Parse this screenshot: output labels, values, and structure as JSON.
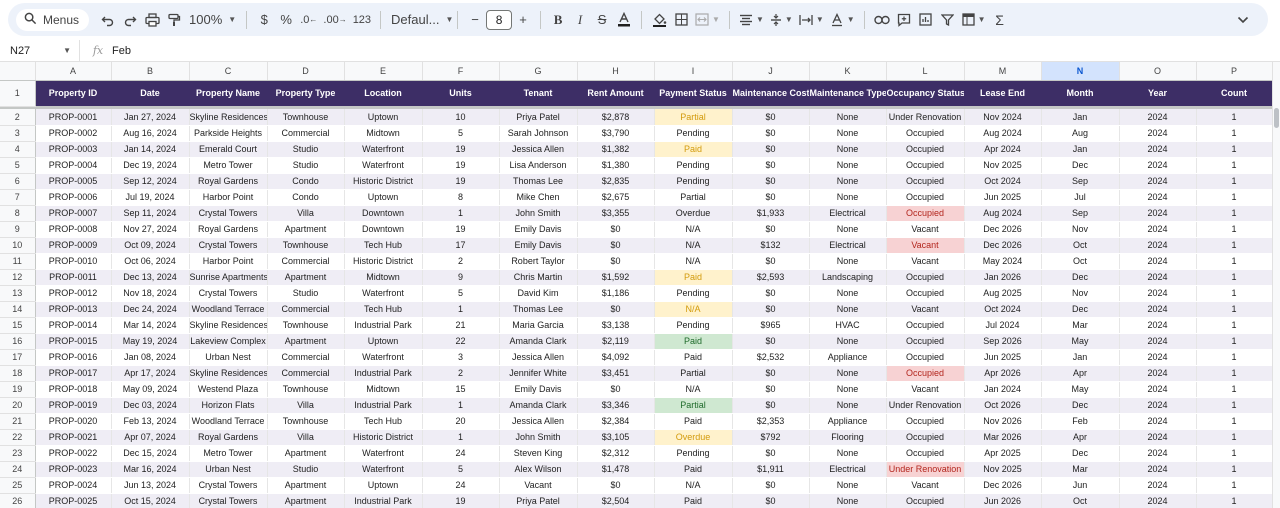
{
  "toolbar": {
    "menus_label": "Menus",
    "zoom": "100%",
    "currency_symbol": "$",
    "percent_symbol": "%",
    "decrease_decimal": ".0",
    "increase_decimal": ".00",
    "number_format": "123",
    "font_name": "Defaul...",
    "font_size": "8"
  },
  "formula_bar": {
    "cell_ref": "N27",
    "value": "Feb"
  },
  "columns": [
    "A",
    "B",
    "C",
    "D",
    "E",
    "F",
    "G",
    "H",
    "I",
    "J",
    "K",
    "L",
    "M",
    "N",
    "O",
    "P"
  ],
  "selected_column": "N",
  "headers": [
    "Property ID",
    "Date",
    "Property Name",
    "Property Type",
    "Location",
    "Units",
    "Tenant",
    "Rent Amount",
    "Payment Status",
    "Maintenance Cost",
    "Maintenance Type",
    "Occupancy Status",
    "Lease End",
    "Month",
    "Year",
    "Count"
  ],
  "rows": [
    [
      "PROP-0001",
      "Jan 27, 2024",
      "Skyline Residences",
      "Townhouse",
      "Uptown",
      "10",
      "Priya Patel",
      "$2,878",
      "Partial",
      "$0",
      "None",
      "Under Renovation",
      "Nov 2024",
      "Jan",
      "2024",
      "1"
    ],
    [
      "PROP-0002",
      "Aug 16, 2024",
      "Parkside Heights",
      "Commercial",
      "Midtown",
      "5",
      "Sarah Johnson",
      "$3,790",
      "Pending",
      "$0",
      "None",
      "Occupied",
      "Aug 2024",
      "Aug",
      "2024",
      "1"
    ],
    [
      "PROP-0003",
      "Jan 14, 2024",
      "Emerald Court",
      "Studio",
      "Waterfront",
      "19",
      "Jessica Allen",
      "$1,382",
      "Paid",
      "$0",
      "None",
      "Occupied",
      "Apr 2024",
      "Jan",
      "2024",
      "1"
    ],
    [
      "PROP-0004",
      "Dec 19, 2024",
      "Metro Tower",
      "Studio",
      "Waterfront",
      "19",
      "Lisa Anderson",
      "$1,380",
      "Pending",
      "$0",
      "None",
      "Occupied",
      "Nov 2025",
      "Dec",
      "2024",
      "1"
    ],
    [
      "PROP-0005",
      "Sep 12, 2024",
      "Royal Gardens",
      "Condo",
      "Historic District",
      "19",
      "Thomas Lee",
      "$2,835",
      "Pending",
      "$0",
      "None",
      "Occupied",
      "Oct 2024",
      "Sep",
      "2024",
      "1"
    ],
    [
      "PROP-0006",
      "Jul 19, 2024",
      "Harbor Point",
      "Condo",
      "Uptown",
      "8",
      "Mike Chen",
      "$2,675",
      "Partial",
      "$0",
      "None",
      "Occupied",
      "Jun 2025",
      "Jul",
      "2024",
      "1"
    ],
    [
      "PROP-0007",
      "Sep 11, 2024",
      "Crystal Towers",
      "Villa",
      "Downtown",
      "1",
      "John Smith",
      "$3,355",
      "Overdue",
      "$1,933",
      "Electrical",
      "Occupied",
      "Aug 2024",
      "Sep",
      "2024",
      "1"
    ],
    [
      "PROP-0008",
      "Nov 27, 2024",
      "Royal Gardens",
      "Apartment",
      "Downtown",
      "19",
      "Emily Davis",
      "$0",
      "N/A",
      "$0",
      "None",
      "Vacant",
      "Dec 2026",
      "Nov",
      "2024",
      "1"
    ],
    [
      "PROP-0009",
      "Oct 09, 2024",
      "Crystal Towers",
      "Townhouse",
      "Tech Hub",
      "17",
      "Emily Davis",
      "$0",
      "N/A",
      "$132",
      "Electrical",
      "Vacant",
      "Dec 2026",
      "Oct",
      "2024",
      "1"
    ],
    [
      "PROP-0010",
      "Oct 06, 2024",
      "Harbor Point",
      "Commercial",
      "Historic District",
      "2",
      "Robert Taylor",
      "$0",
      "N/A",
      "$0",
      "None",
      "Vacant",
      "May 2024",
      "Oct",
      "2024",
      "1"
    ],
    [
      "PROP-0011",
      "Dec 13, 2024",
      "Sunrise Apartments",
      "Apartment",
      "Midtown",
      "9",
      "Chris Martin",
      "$1,592",
      "Paid",
      "$2,593",
      "Landscaping",
      "Occupied",
      "Jan 2026",
      "Dec",
      "2024",
      "1"
    ],
    [
      "PROP-0012",
      "Nov 18, 2024",
      "Crystal Towers",
      "Studio",
      "Waterfront",
      "5",
      "David Kim",
      "$1,186",
      "Pending",
      "$0",
      "None",
      "Occupied",
      "Aug 2025",
      "Nov",
      "2024",
      "1"
    ],
    [
      "PROP-0013",
      "Dec 24, 2024",
      "Woodland Terrace",
      "Commercial",
      "Tech Hub",
      "1",
      "Thomas Lee",
      "$0",
      "N/A",
      "$0",
      "None",
      "Vacant",
      "Oct 2024",
      "Dec",
      "2024",
      "1"
    ],
    [
      "PROP-0014",
      "Mar 14, 2024",
      "Skyline Residences",
      "Townhouse",
      "Industrial Park",
      "21",
      "Maria Garcia",
      "$3,138",
      "Pending",
      "$965",
      "HVAC",
      "Occupied",
      "Jul 2024",
      "Mar",
      "2024",
      "1"
    ],
    [
      "PROP-0015",
      "May 19, 2024",
      "Lakeview Complex",
      "Apartment",
      "Uptown",
      "22",
      "Amanda Clark",
      "$2,119",
      "Paid",
      "$0",
      "None",
      "Occupied",
      "Sep 2026",
      "May",
      "2024",
      "1"
    ],
    [
      "PROP-0016",
      "Jan 08, 2024",
      "Urban Nest",
      "Commercial",
      "Waterfront",
      "3",
      "Jessica Allen",
      "$4,092",
      "Paid",
      "$2,532",
      "Appliance",
      "Occupied",
      "Jun 2025",
      "Jan",
      "2024",
      "1"
    ],
    [
      "PROP-0017",
      "Apr 17, 2024",
      "Skyline Residences",
      "Commercial",
      "Industrial Park",
      "2",
      "Jennifer White",
      "$3,451",
      "Partial",
      "$0",
      "None",
      "Occupied",
      "Apr 2026",
      "Apr",
      "2024",
      "1"
    ],
    [
      "PROP-0018",
      "May 09, 2024",
      "Westend Plaza",
      "Townhouse",
      "Midtown",
      "15",
      "Emily Davis",
      "$0",
      "N/A",
      "$0",
      "None",
      "Vacant",
      "Jan 2024",
      "May",
      "2024",
      "1"
    ],
    [
      "PROP-0019",
      "Dec 03, 2024",
      "Horizon Flats",
      "Villa",
      "Industrial Park",
      "1",
      "Amanda Clark",
      "$3,346",
      "Partial",
      "$0",
      "None",
      "Under Renovation",
      "Oct 2026",
      "Dec",
      "2024",
      "1"
    ],
    [
      "PROP-0020",
      "Feb 13, 2024",
      "Woodland Terrace",
      "Townhouse",
      "Tech Hub",
      "20",
      "Jessica Allen",
      "$2,384",
      "Paid",
      "$2,353",
      "Appliance",
      "Occupied",
      "Nov 2026",
      "Feb",
      "2024",
      "1"
    ],
    [
      "PROP-0021",
      "Apr 07, 2024",
      "Royal Gardens",
      "Villa",
      "Historic District",
      "1",
      "John Smith",
      "$3,105",
      "Overdue",
      "$792",
      "Flooring",
      "Occupied",
      "Mar 2026",
      "Apr",
      "2024",
      "1"
    ],
    [
      "PROP-0022",
      "Dec 15, 2024",
      "Metro Tower",
      "Apartment",
      "Waterfront",
      "24",
      "Steven King",
      "$2,312",
      "Pending",
      "$0",
      "None",
      "Occupied",
      "Apr 2025",
      "Dec",
      "2024",
      "1"
    ],
    [
      "PROP-0023",
      "Mar 16, 2024",
      "Urban Nest",
      "Studio",
      "Waterfront",
      "5",
      "Alex Wilson",
      "$1,478",
      "Paid",
      "$1,911",
      "Electrical",
      "Under Renovation",
      "Nov 2025",
      "Mar",
      "2024",
      "1"
    ],
    [
      "PROP-0024",
      "Jun 13, 2024",
      "Crystal Towers",
      "Apartment",
      "Uptown",
      "24",
      "Vacant",
      "$0",
      "N/A",
      "$0",
      "None",
      "Vacant",
      "Dec 2026",
      "Jun",
      "2024",
      "1"
    ],
    [
      "PROP-0025",
      "Oct 15, 2024",
      "Crystal Towers",
      "Apartment",
      "Industrial Park",
      "19",
      "Priya Patel",
      "$2,504",
      "Paid",
      "$0",
      "None",
      "Occupied",
      "Jun 2026",
      "Oct",
      "2024",
      "1"
    ]
  ],
  "highlighted_cells": {
    "pending_rows": [
      2,
      4,
      12,
      14,
      22
    ],
    "paid_green_rows": [
      16,
      20
    ],
    "vacant_red_rows": [
      8,
      10,
      18,
      24
    ]
  },
  "colors": {
    "header_bg": "#3d2e66",
    "header_text": "#ffffff",
    "band_odd": "#efedf5",
    "pending_bg": "#fff2cc",
    "paid_bg": "#cfe8d1",
    "vacant_bg": "#f7d2d3"
  },
  "icons": [
    "search-icon",
    "undo-icon",
    "redo-icon",
    "print-icon",
    "paint-format-icon",
    "bold-icon",
    "italic-icon",
    "strikethrough-icon",
    "text-color-icon",
    "fill-color-icon",
    "borders-icon",
    "merge-icon",
    "align-icon",
    "valign-icon",
    "wrap-icon",
    "rotate-icon",
    "link-icon",
    "comment-icon",
    "chart-icon",
    "filter-icon",
    "views-icon",
    "function-icon",
    "collapse-icon"
  ]
}
